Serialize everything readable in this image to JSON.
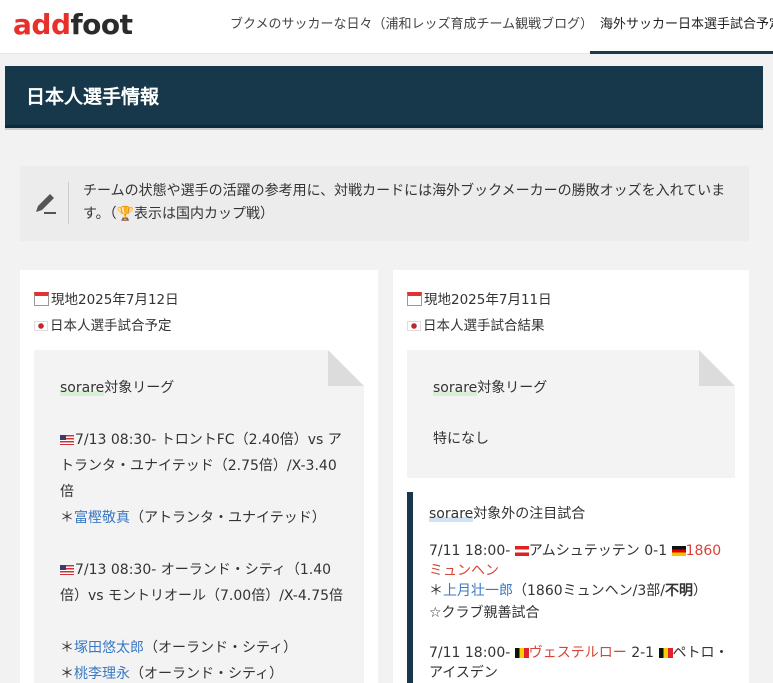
{
  "header": {
    "logo_part1": "add",
    "logo_part2": "foot",
    "nav": [
      "ブクメのサッカーな日々（浦和レッズ育成チーム観戦ブログ）",
      "海外サッカー日本選手試合予定"
    ]
  },
  "page": {
    "title": "日本人選手情報"
  },
  "note": {
    "icon": "pencil-icon",
    "text_before_trophy": "チームの状態や選手の活躍の参考用に、対戦カードには海外ブックメーカーの勝敗オッズを入れています。（",
    "trophy": "🏆",
    "text_after_trophy": "表示は国内カップ戦）"
  },
  "left": {
    "date": "現地2025年7月12日",
    "subtitle": "日本人選手試合予定",
    "league_prefix": "sorare",
    "league_suffix": "対象リーグ",
    "matches": [
      {
        "text": "7/13 08:30- トロントFC（2.40倍）vs アトランタ・ユナイテッド（2.75倍）/X-3.40倍",
        "players": [
          {
            "name": "富樫敬真",
            "team": "（アトランタ・ユナイテッド）"
          }
        ]
      },
      {
        "text": "7/13 08:30- オーランド・シティ（1.40倍）vs モントリオール（7.00倍）/X-4.75倍",
        "players": [
          {
            "name": "塚田悠太郎",
            "team": "（オーランド・シティ）"
          },
          {
            "name": "桃李理永",
            "team": "（オーランド・シティ）"
          }
        ]
      }
    ]
  },
  "right": {
    "date": "現地2025年7月11日",
    "subtitle": "日本人選手試合結果",
    "league_prefix": "sorare",
    "league_suffix": "対象リーグ",
    "none_text": "特になし",
    "notable_prefix": "sorare",
    "notable_suffix": "対象外の注目試合",
    "results": [
      {
        "time": "7/11 18:00-",
        "home": "アムシュテッテン",
        "score": "0-1",
        "away": "1860ミュンヘン",
        "player": "上月壮一郎",
        "detail_before": "（1860ミュンヘン/3部/",
        "detail_bold": "不明",
        "detail_after": "）",
        "note": "☆クラブ親善試合"
      },
      {
        "time": "7/11 18:00-",
        "home": "ヴェステルロー",
        "score": "2-1",
        "away": "ペトロ・アイスデン"
      }
    ]
  }
}
